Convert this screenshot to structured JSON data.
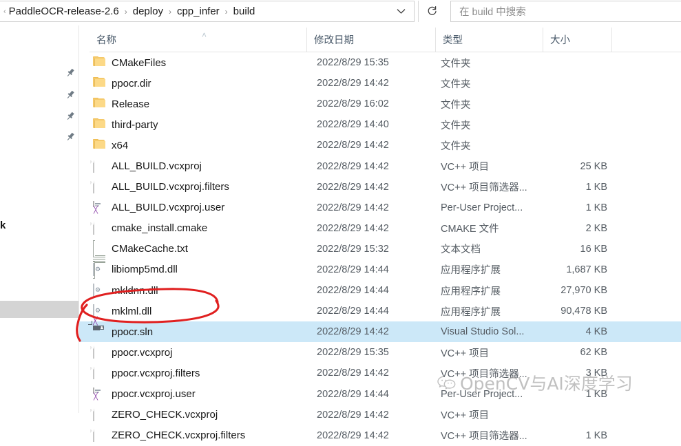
{
  "window": {
    "address": {
      "breadcrumbs": [
        "PaddleOCR-release-2.6",
        "deploy",
        "cpp_infer",
        "build"
      ],
      "separator": "›",
      "leading_chevron": "«",
      "dropdown_icon": "chevron-down-icon"
    },
    "refresh_label": "↻",
    "search": {
      "placeholder": "在 build 中搜索",
      "value": ""
    }
  },
  "columns": {
    "name": "名称",
    "date": "修改日期",
    "type": "类型",
    "size": "大小",
    "sort_arrow": "˄"
  },
  "sidebar": {
    "pin_count": 4,
    "pin_icon": "pin-icon",
    "fragment_text": "k"
  },
  "files": [
    {
      "name": "CMakeFiles",
      "date": "2022/8/29 15:35",
      "type": "文件夹",
      "size": "",
      "icon": "folder",
      "selected": false
    },
    {
      "name": "ppocr.dir",
      "date": "2022/8/29 14:42",
      "type": "文件夹",
      "size": "",
      "icon": "folder",
      "selected": false
    },
    {
      "name": "Release",
      "date": "2022/8/29 16:02",
      "type": "文件夹",
      "size": "",
      "icon": "folder",
      "selected": false
    },
    {
      "name": "third-party",
      "date": "2022/8/29 14:40",
      "type": "文件夹",
      "size": "",
      "icon": "folder",
      "selected": false
    },
    {
      "name": "x64",
      "date": "2022/8/29 14:42",
      "type": "文件夹",
      "size": "",
      "icon": "folder",
      "selected": false
    },
    {
      "name": "ALL_BUILD.vcxproj",
      "date": "2022/8/29 14:42",
      "type": "VC++ 项目",
      "size": "25 KB",
      "icon": "doc",
      "selected": false
    },
    {
      "name": "ALL_BUILD.vcxproj.filters",
      "date": "2022/8/29 14:42",
      "type": "VC++ 项目筛选器...",
      "size": "1 KB",
      "icon": "doc",
      "selected": false
    },
    {
      "name": "ALL_BUILD.vcxproj.user",
      "date": "2022/8/29 14:42",
      "type": "Per-User Project...",
      "size": "1 KB",
      "icon": "vsuser",
      "selected": false
    },
    {
      "name": "cmake_install.cmake",
      "date": "2022/8/29 14:42",
      "type": "CMAKE 文件",
      "size": "2 KB",
      "icon": "doc",
      "selected": false
    },
    {
      "name": "CMakeCache.txt",
      "date": "2022/8/29 15:32",
      "type": "文本文档",
      "size": "16 KB",
      "icon": "txt",
      "selected": false
    },
    {
      "name": "libiomp5md.dll",
      "date": "2022/8/29 14:44",
      "type": "应用程序扩展",
      "size": "1,687 KB",
      "icon": "dll",
      "selected": false
    },
    {
      "name": "mkldnn.dll",
      "date": "2022/8/29 14:44",
      "type": "应用程序扩展",
      "size": "27,970 KB",
      "icon": "dll",
      "selected": false
    },
    {
      "name": "mklml.dll",
      "date": "2022/8/29 14:44",
      "type": "应用程序扩展",
      "size": "90,478 KB",
      "icon": "dll",
      "selected": false
    },
    {
      "name": "ppocr.sln",
      "date": "2022/8/29 14:42",
      "type": "Visual Studio Sol...",
      "size": "4 KB",
      "icon": "sln",
      "selected": true
    },
    {
      "name": "ppocr.vcxproj",
      "date": "2022/8/29 15:35",
      "type": "VC++ 项目",
      "size": "62 KB",
      "icon": "doc",
      "selected": false
    },
    {
      "name": "ppocr.vcxproj.filters",
      "date": "2022/8/29 14:42",
      "type": "VC++ 项目筛选器...",
      "size": "3 KB",
      "icon": "doc",
      "selected": false
    },
    {
      "name": "ppocr.vcxproj.user",
      "date": "2022/8/29 14:44",
      "type": "Per-User Project...",
      "size": "1 KB",
      "icon": "vsuser",
      "selected": false
    },
    {
      "name": "ZERO_CHECK.vcxproj",
      "date": "2022/8/29 14:42",
      "type": "VC++ 项目",
      "size": "",
      "icon": "doc",
      "selected": false
    },
    {
      "name": "ZERO_CHECK.vcxproj.filters",
      "date": "2022/8/29 14:42",
      "type": "VC++ 项目筛选器...",
      "size": "1 KB",
      "icon": "doc",
      "selected": false
    }
  ],
  "watermark": {
    "text": "OpenCV与AI深度学习",
    "icon": "wechat-icon"
  },
  "annotation": {
    "shape": "red-ellipse-circle",
    "color": "#e02020",
    "target": "ppocr.sln"
  },
  "colors": {
    "selection": "#cce8f8",
    "folder": "#fcd987",
    "accent_red": "#e02020",
    "text": "#171717",
    "muted": "#555c63"
  }
}
